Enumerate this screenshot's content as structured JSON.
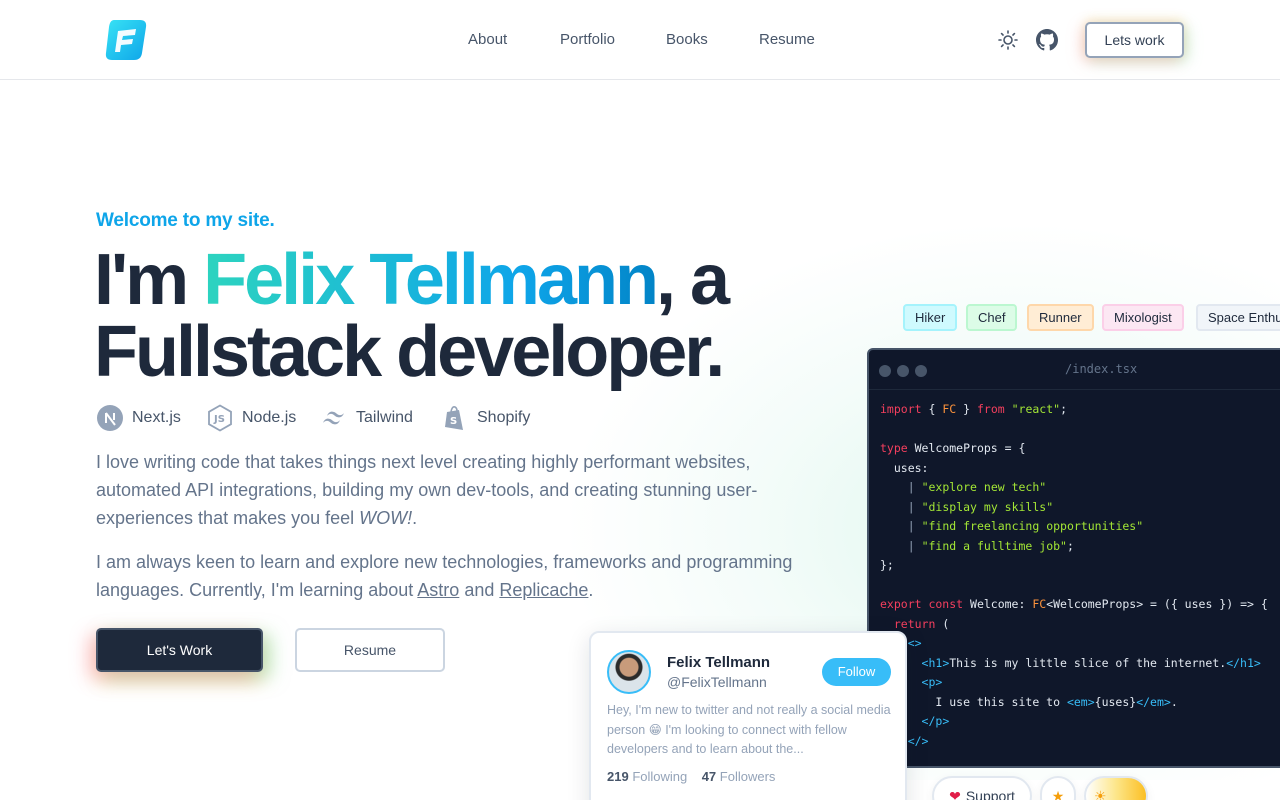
{
  "header": {
    "nav": [
      "About",
      "Portfolio",
      "Books",
      "Resume"
    ],
    "cta": "Lets work",
    "icons": [
      "sun-icon",
      "github-icon"
    ]
  },
  "hero": {
    "welcome": "Welcome to my site.",
    "title_pre": "I'm ",
    "title_name": "Felix Tellmann",
    "title_post": ", a Fullstack developer.",
    "tech": [
      "Next.js",
      "Node.js",
      "Tailwind",
      "Shopify"
    ],
    "para1_a": "I love writing code that takes things next level creating highly performant websites, automated API integrations, building my own dev-tools, and creating stunning user-experiences that makes you feel ",
    "para1_em": "WOW!",
    "para1_b": ".",
    "para2_a": "I am always keen to learn and explore new technologies, frameworks and programming languages. Currently, I'm learning about ",
    "para2_link1": "Astro",
    "para2_mid": " and ",
    "para2_link2": "Replicache",
    "para2_end": ".",
    "btn_work": "Let's Work",
    "btn_resume": "Resume"
  },
  "tags": [
    "Hiker",
    "Chef",
    "Runner",
    "Mixologist",
    "Space Enthu"
  ],
  "code": {
    "filename": "/index.tsx"
  },
  "twitter": {
    "name": "Felix Tellmann",
    "handle": "@FelixTellmann",
    "follow": "Follow",
    "bio": "Hey, I'm new to twitter and not really a social media person 😁 I'm looking to connect with fellow developers and to learn about the...",
    "following_count": "219",
    "following_label": "Following",
    "followers_count": "47",
    "followers_label": "Followers"
  },
  "footer_pills": {
    "support": "Support"
  },
  "colors": {
    "accent": "#0ea5e9",
    "dark": "#1e293b"
  }
}
